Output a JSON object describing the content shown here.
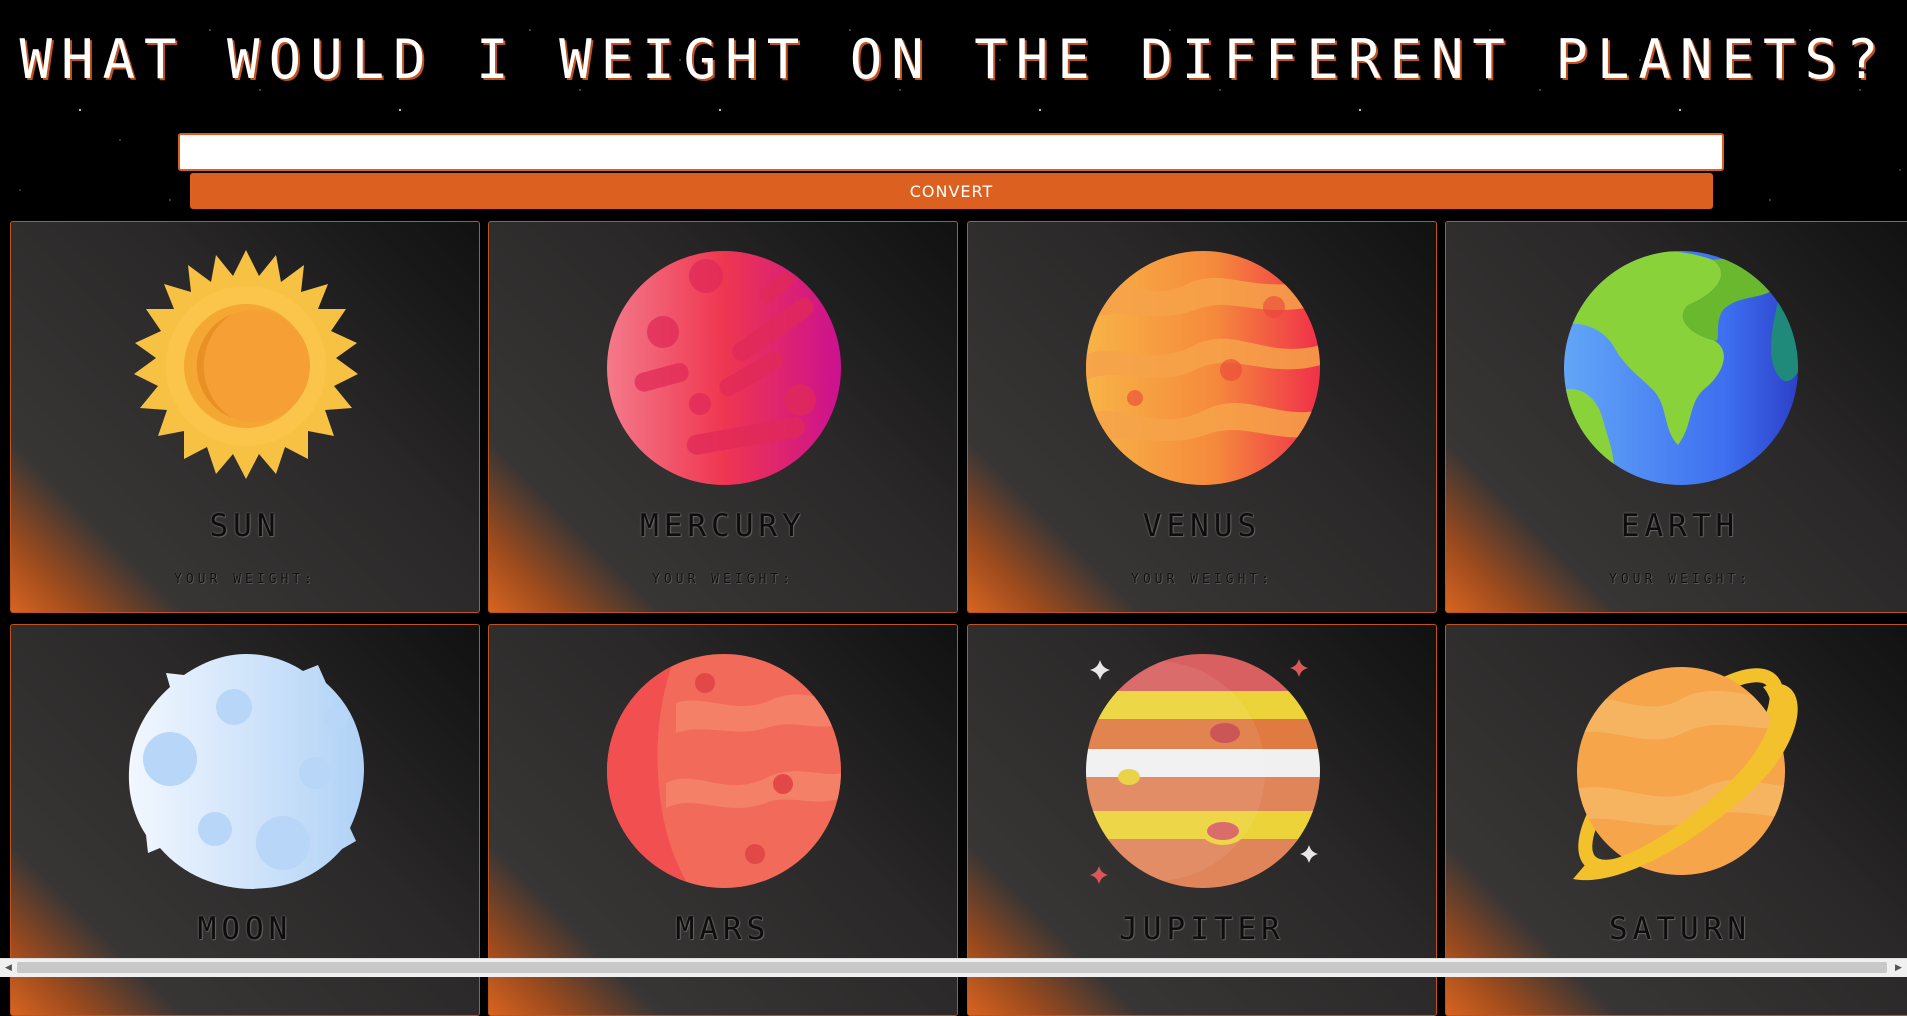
{
  "page": {
    "title": "WHAT WOULD I WEIGHT ON THE DIFFERENT PLANETS?",
    "input_value": "",
    "convert_label": "CONVERT"
  },
  "planets": [
    {
      "name": "SUN",
      "weight_label": "YOUR WEIGHT:",
      "icon": "sun-icon"
    },
    {
      "name": "MERCURY",
      "weight_label": "YOUR WEIGHT:",
      "icon": "mercury-icon"
    },
    {
      "name": "VENUS",
      "weight_label": "YOUR WEIGHT:",
      "icon": "venus-icon"
    },
    {
      "name": "EARTH",
      "weight_label": "YOUR WEIGHT:",
      "icon": "earth-icon"
    },
    {
      "name": "MOON",
      "icon": "moon-icon"
    },
    {
      "name": "MARS",
      "icon": "mars-icon"
    },
    {
      "name": "JUPITER",
      "icon": "jupiter-icon"
    },
    {
      "name": "SATURN",
      "icon": "saturn-icon"
    }
  ],
  "colors": {
    "accent": "#dc6020",
    "background": "#000000",
    "card": "#2a2828"
  },
  "scrollbar": {
    "left_arrow": "◀",
    "right_arrow": "▶"
  }
}
